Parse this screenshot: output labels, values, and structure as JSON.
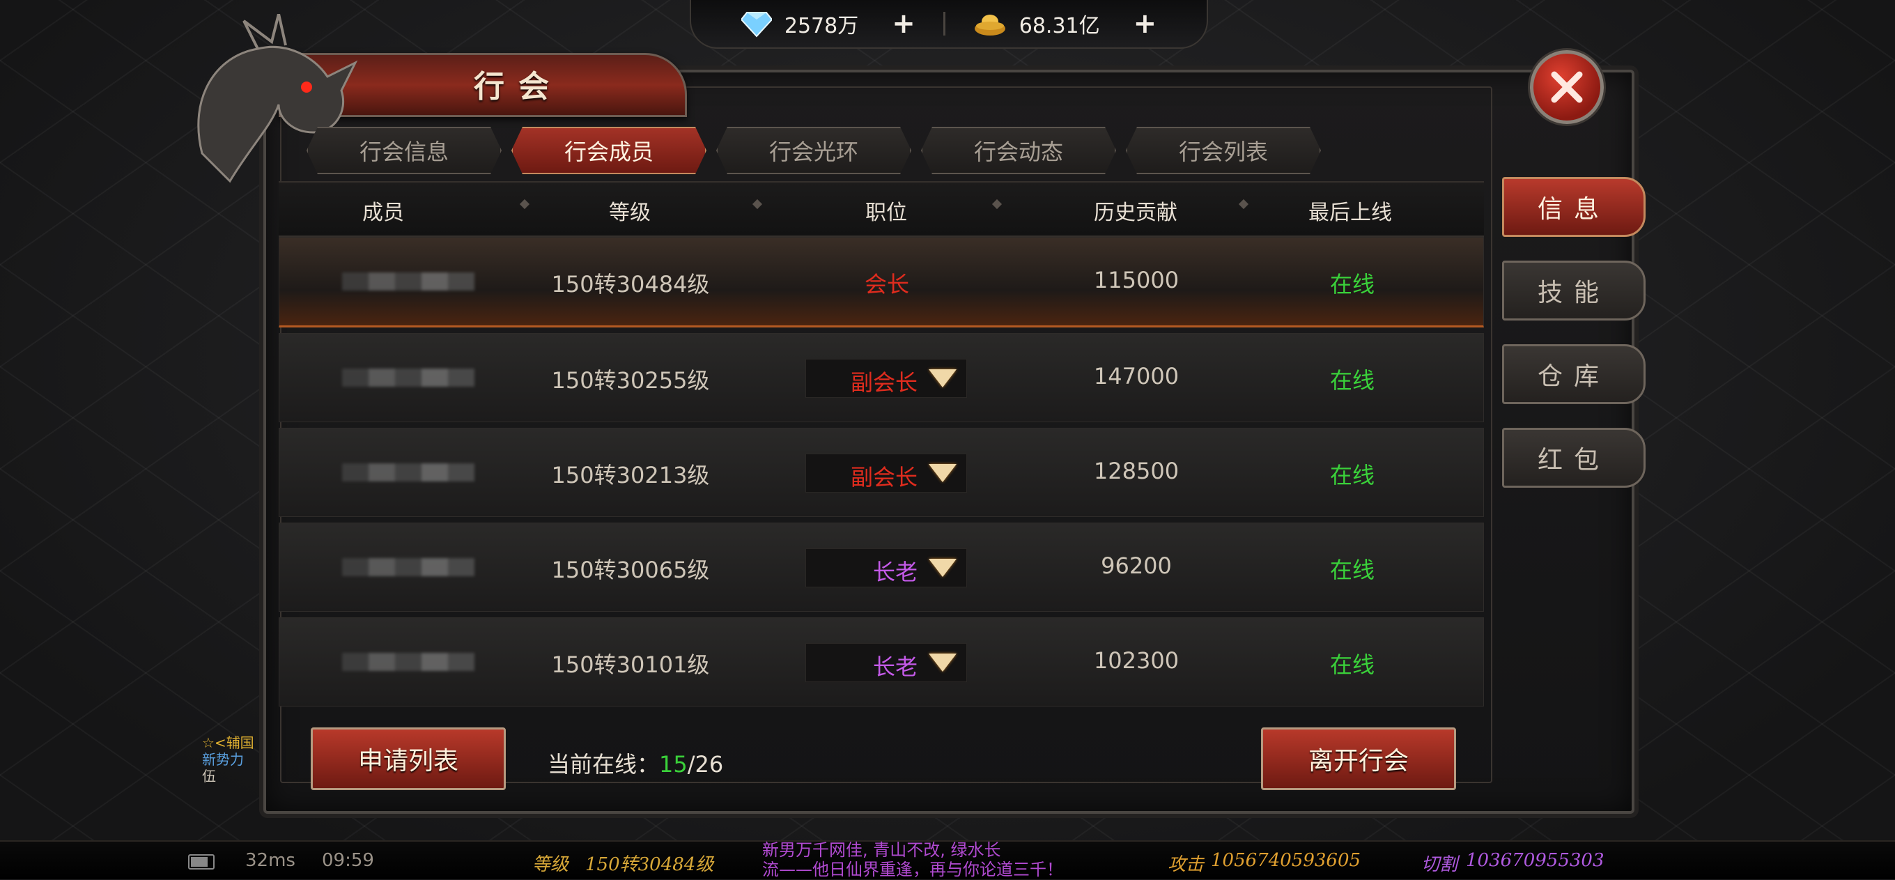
{
  "currency": {
    "diamond_value": "2578万",
    "gold_value": "68.31亿",
    "plus": "+"
  },
  "window": {
    "title": "行会"
  },
  "tabs": [
    {
      "label": "行会信息",
      "active": false
    },
    {
      "label": "行会成员",
      "active": true
    },
    {
      "label": "行会光环",
      "active": false
    },
    {
      "label": "行会动态",
      "active": false
    },
    {
      "label": "行会列表",
      "active": false
    }
  ],
  "columns": {
    "member": "成员",
    "level": "等级",
    "position": "职位",
    "contribution": "历史贡献",
    "last_online": "最后上线"
  },
  "members": [
    {
      "level": "150转30484级",
      "position": "会长",
      "contribution": "115000",
      "last_online": "在线",
      "editable": false,
      "position_color": "#e02c1e"
    },
    {
      "level": "150转30255级",
      "position": "副会长",
      "contribution": "147000",
      "last_online": "在线",
      "editable": true,
      "position_color": "#e02c1e"
    },
    {
      "level": "150转30213级",
      "position": "副会长",
      "contribution": "128500",
      "last_online": "在线",
      "editable": true,
      "position_color": "#e02c1e"
    },
    {
      "level": "150转30065级",
      "position": "长老",
      "contribution": "96200",
      "last_online": "在线",
      "editable": true,
      "position_color": "#c45ae8"
    },
    {
      "level": "150转30101级",
      "position": "长老",
      "contribution": "102300",
      "last_online": "在线",
      "editable": true,
      "position_color": "#c45ae8"
    }
  ],
  "side_tabs": [
    {
      "label": "信息",
      "active": true
    },
    {
      "label": "技能",
      "active": false
    },
    {
      "label": "仓库",
      "active": false
    },
    {
      "label": "红包",
      "active": false
    }
  ],
  "footer": {
    "apply_list_label": "申请列表",
    "online_label": "当前在线：",
    "online_count": "15",
    "online_total": "/26",
    "leave_label": "离开行会"
  },
  "status_bar": {
    "ping": "32ms",
    "time": "09:59",
    "level_label": "等级",
    "level_value": "150转30484级",
    "chat_line1": "新男万千网佳, 青山不改, 绿水长",
    "chat_line2": "流——他日仙界重逢，再与你论道三千！",
    "attack_label": "攻击",
    "attack_value": "1056740593605",
    "cut_label": "切割",
    "cut_value": "103670955303"
  },
  "left_chat": {
    "line1": "☆<辅国",
    "line2": "新势力",
    "line3": "伍"
  },
  "colors": {
    "accent_red": "#a33226",
    "online_green": "#3ad13a",
    "leader_red": "#e02c1e",
    "elder_purple": "#c45ae8"
  }
}
